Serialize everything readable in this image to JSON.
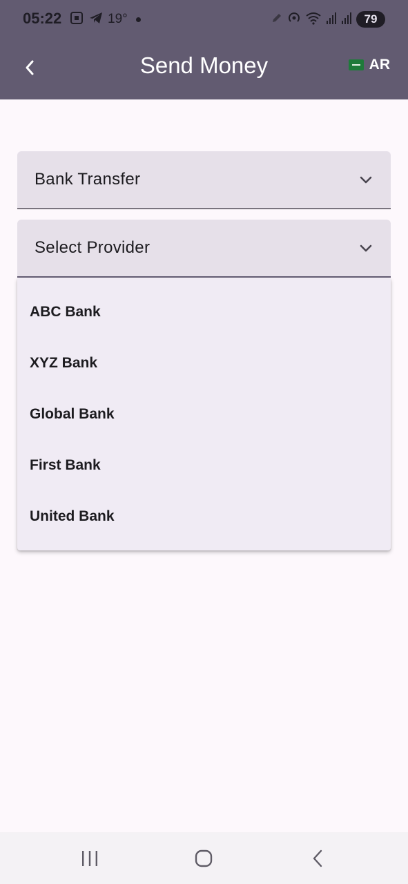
{
  "status_bar": {
    "time": "05:22",
    "temperature": "19°",
    "battery": "79",
    "icons": [
      "screenshot-icon",
      "telegram-icon",
      "dot-icon",
      "pen-icon",
      "hotspot-icon",
      "wifi-icon",
      "signal-icon",
      "signal-icon",
      "battery-charging-icon"
    ]
  },
  "app_bar": {
    "title": "Send Money",
    "back_icon": "chevron-left-icon",
    "language": "AR",
    "flag_icon": "saudi-flag-icon",
    "background": "#625b71"
  },
  "form": {
    "transfer_type": {
      "value": "Bank Transfer",
      "icon": "chevron-down-icon"
    },
    "provider": {
      "placeholder": "Select Provider",
      "icon": "chevron-down-icon",
      "options": [
        "ABC Bank",
        "XYZ Bank",
        "Global Bank",
        "First Bank",
        "United Bank"
      ]
    }
  },
  "nav_bar": {
    "buttons": [
      "recents-icon",
      "home-icon",
      "back-icon"
    ]
  },
  "colors": {
    "field_background": "#e6e0e9",
    "dropdown_background": "#f0ebf4",
    "page_background": "#fdf8fc"
  }
}
